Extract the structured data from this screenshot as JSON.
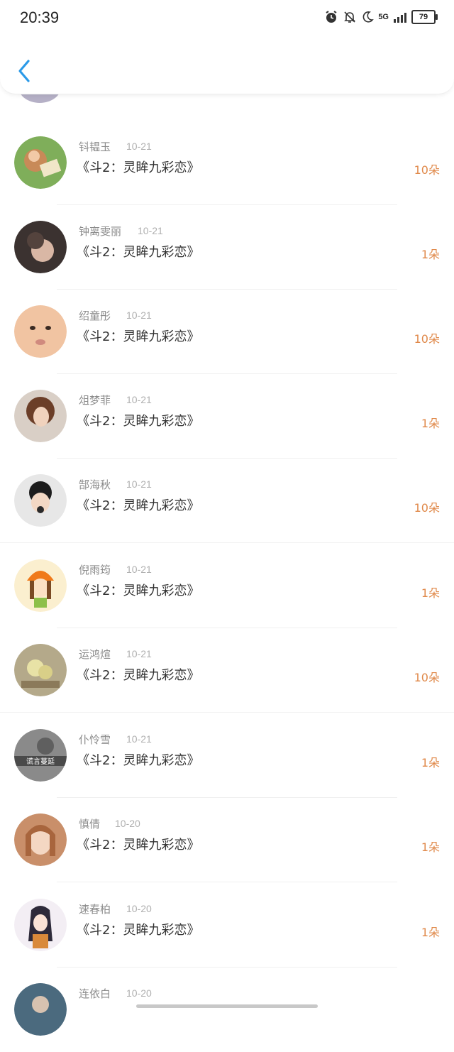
{
  "status": {
    "time": "20:39",
    "network": "5G",
    "battery": "79",
    "icons": [
      "alarm-icon",
      "bell-muted-icon",
      "moon-icon",
      "signal-icon",
      "battery-icon"
    ]
  },
  "nav": {
    "back_icon": "chevron-left-icon",
    "accent": "#2b9ae8"
  },
  "colors": {
    "amount": "#e0894a",
    "name": "#8b8b8b",
    "title": "#333333"
  },
  "items": [
    {
      "name": "钭韫玉",
      "date": "10-21",
      "title": "《斗2：灵眸九彩恋》",
      "amount": "10朵"
    },
    {
      "name": "钟离雯丽",
      "date": "10-21",
      "title": "《斗2：灵眸九彩恋》",
      "amount": "1朵"
    },
    {
      "name": "绍童彤",
      "date": "10-21",
      "title": "《斗2：灵眸九彩恋》",
      "amount": "10朵"
    },
    {
      "name": "俎梦菲",
      "date": "10-21",
      "title": "《斗2：灵眸九彩恋》",
      "amount": "1朵"
    },
    {
      "name": "郜海秋",
      "date": "10-21",
      "title": "《斗2：灵眸九彩恋》",
      "amount": "10朵"
    },
    {
      "name": "倪雨筠",
      "date": "10-21",
      "title": "《斗2：灵眸九彩恋》",
      "amount": "1朵"
    },
    {
      "name": "运鸿煊",
      "date": "10-21",
      "title": "《斗2：灵眸九彩恋》",
      "amount": "10朵"
    },
    {
      "name": "仆怜雪",
      "date": "10-21",
      "title": "《斗2：灵眸九彩恋》",
      "amount": "1朵",
      "avatar_text": "谎言蔓延"
    },
    {
      "name": "慎倩",
      "date": "10-20",
      "title": "《斗2：灵眸九彩恋》",
      "amount": "1朵"
    },
    {
      "name": "速春柏",
      "date": "10-20",
      "title": "《斗2：灵眸九彩恋》",
      "amount": "1朵"
    },
    {
      "name": "连依白",
      "date": "10-20"
    }
  ]
}
